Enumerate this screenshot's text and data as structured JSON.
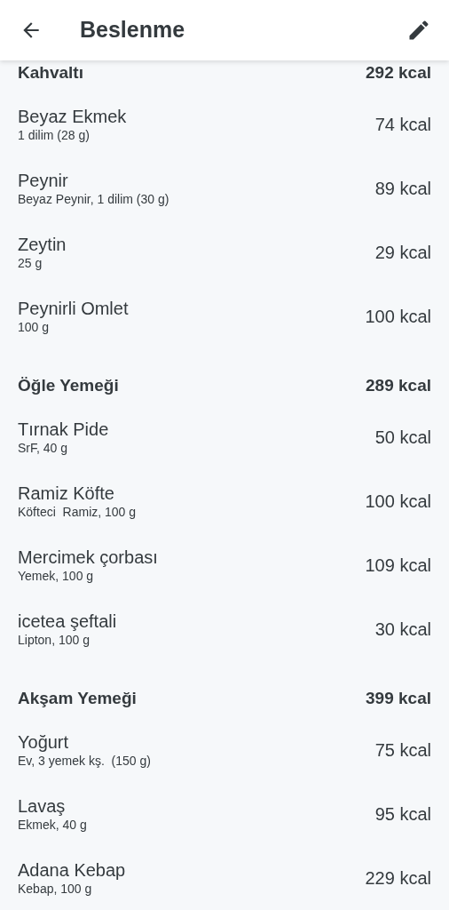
{
  "app_bar": {
    "title": "Beslenme"
  },
  "meals": [
    {
      "name": "Kahvaltı",
      "total": "292 kcal",
      "foods": [
        {
          "name": "Beyaz Ekmek",
          "detail": "1 dilim (28 g)",
          "kcal": "74 kcal"
        },
        {
          "name": "Peynir",
          "detail": "Beyaz Peynir, 1 dilim (30 g)",
          "kcal": "89 kcal"
        },
        {
          "name": "Zeytin",
          "detail": "25 g",
          "kcal": "29 kcal"
        },
        {
          "name": "Peynirli Omlet",
          "detail": "100 g",
          "kcal": "100 kcal"
        }
      ]
    },
    {
      "name": "Öğle Yemeği",
      "total": "289 kcal",
      "foods": [
        {
          "name": "Tırnak Pide",
          "detail": "SrF, 40 g",
          "kcal": "50 kcal"
        },
        {
          "name": "Ramiz Köfte",
          "detail": "Köfteci  Ramiz, 100 g",
          "kcal": "100 kcal"
        },
        {
          "name": "Mercimek çorbası",
          "detail": "Yemek, 100 g",
          "kcal": "109 kcal"
        },
        {
          "name": "icetea şeftali",
          "detail": "Lipton, 100 g",
          "kcal": "30 kcal"
        }
      ]
    },
    {
      "name": "Akşam Yemeği",
      "total": "399 kcal",
      "foods": [
        {
          "name": "Yoğurt",
          "detail": "Ev, 3 yemek kş.  (150 g)",
          "kcal": "75 kcal"
        },
        {
          "name": "Lavaş",
          "detail": "Ekmek, 40 g",
          "kcal": "95 kcal"
        },
        {
          "name": "Adana Kebap",
          "detail": "Kebap, 100 g",
          "kcal": "229 kcal"
        }
      ]
    }
  ]
}
